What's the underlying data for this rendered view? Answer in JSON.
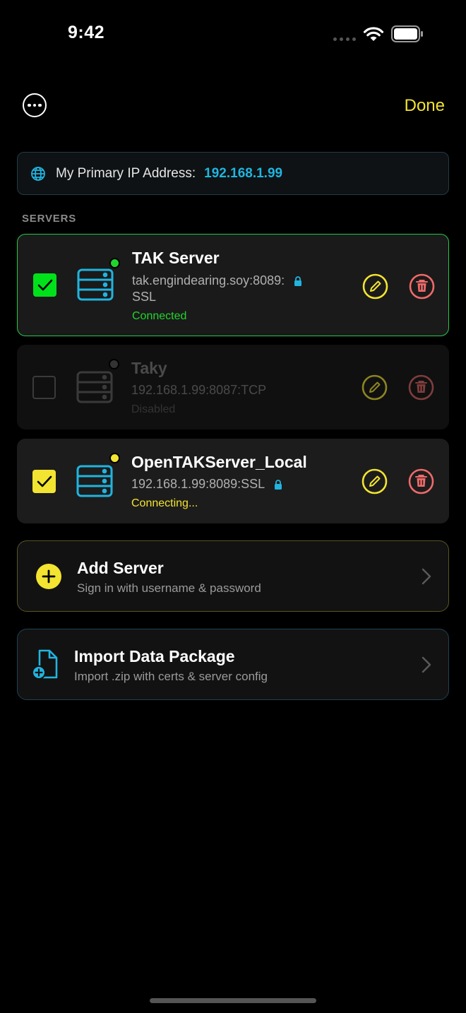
{
  "status_bar": {
    "time": "9:42"
  },
  "nav": {
    "done_label": "Done"
  },
  "ip_card": {
    "label": "My Primary IP Address:",
    "value": "192.168.1.99",
    "icon": "globe-icon"
  },
  "section": {
    "header": "SERVERS"
  },
  "servers": [
    {
      "name": "TAK Server",
      "address_line1": "tak.engindearing.soy:8089:",
      "address_line2": "SSL",
      "status": "Connected",
      "checked": true,
      "secure": true,
      "status_color": "#22d52e",
      "accent": "#00e11b"
    },
    {
      "name": "Taky",
      "address_line1": "192.168.1.99:8087:TCP",
      "status": "Disabled",
      "checked": false,
      "secure": false,
      "status_color": "#444444"
    },
    {
      "name": "OpenTAKServer_Local",
      "address_line1": "192.168.1.99:8089:SSL",
      "status": "Connecting...",
      "checked": true,
      "secure": true,
      "status_color": "#f2e431",
      "accent": "#f2e431"
    }
  ],
  "actions": {
    "add_server": {
      "title": "Add Server",
      "subtitle": "Sign in with username & password",
      "icon": "plus-circle-icon"
    },
    "import_package": {
      "title": "Import Data Package",
      "subtitle": "Import .zip with certs & server config",
      "icon": "document-add-icon"
    }
  },
  "colors": {
    "accent_yellow": "#f2e431",
    "accent_cyan": "#21b4de",
    "connected_green": "#22d52e",
    "delete_red": "#f06a6a",
    "background": "#000000"
  }
}
